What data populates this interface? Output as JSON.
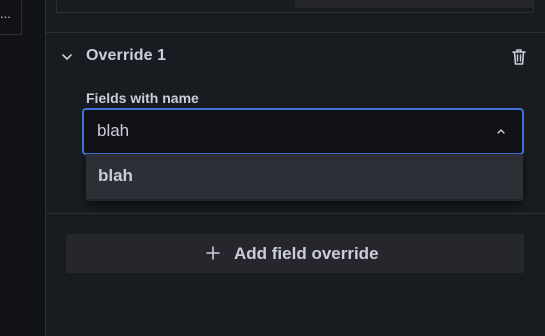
{
  "left_panel": {
    "item_text": "..."
  },
  "override": {
    "title": "Override 1",
    "collapse_icon": "chevron-down-icon",
    "delete_icon": "trash-icon",
    "matcher_label": "Fields with name",
    "selected_value": "blah",
    "dropdown_open": true,
    "options": [
      "blah"
    ]
  },
  "add_override": {
    "label": "Add field override",
    "icon": "plus-icon"
  },
  "colors": {
    "focus_border": "#3d71d9",
    "background": "#181b1f",
    "text": "#ccccdc"
  }
}
